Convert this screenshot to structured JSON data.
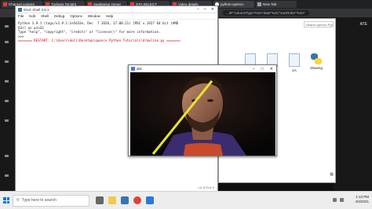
{
  "browser": {
    "tabs": [
      {
        "label": "Channel content",
        "fav": "red"
      },
      {
        "label": "Turbans Tonight",
        "fav": "red"
      },
      {
        "label": "Sagittarius Gener",
        "fav": "red"
      },
      {
        "label": "STA SELECT",
        "fav": "red"
      },
      {
        "label": "Video details",
        "fav": "red"
      },
      {
        "label": "python-opencv",
        "fav": "gh"
      },
      {
        "label": "New Tab",
        "fav": "gray"
      }
    ],
    "url": "...2F\"columnType\"%3A\"date\"%2C\"sortOrder\"%3A\""
  },
  "idle": {
    "title": "IDLE Shell 3.9.1",
    "menu": [
      "File",
      "Edit",
      "Shell",
      "Debug",
      "Options",
      "Window",
      "Help"
    ],
    "lines": [
      "Python 3.9.1 (tags/v3.9.1:1e5d33e, Dec  7 2020, 17:08:21) [MSC v.1927 64 bit (AMD",
      "64)] on win32",
      "Type \"help\", \"copyright\", \"credits\" or \"license()\" for more information.",
      ">>> ",
      "======= RESTART: C:\\Users\\dell\\Desktop\\opencv Python Tutorials\\drawline.py ======="
    ],
    "status": "Ln: 6 Col: 0"
  },
  "explorer": {
    "search_placeholder": "Search opencv Python Tutori...",
    "files": [
      {
        "name": "",
        "kind": "doc"
      },
      {
        "name": "",
        "kind": "doc"
      },
      {
        "name": "1A",
        "kind": "doc"
      },
      {
        "name": "drawing",
        "kind": "py"
      }
    ]
  },
  "cv_window": {
    "title": "abc"
  },
  "right_page": {
    "label": "ATE"
  },
  "taskbar": {
    "search_placeholder": "Type here to search",
    "time": "1:13 PM",
    "date": "4/3/2021"
  }
}
